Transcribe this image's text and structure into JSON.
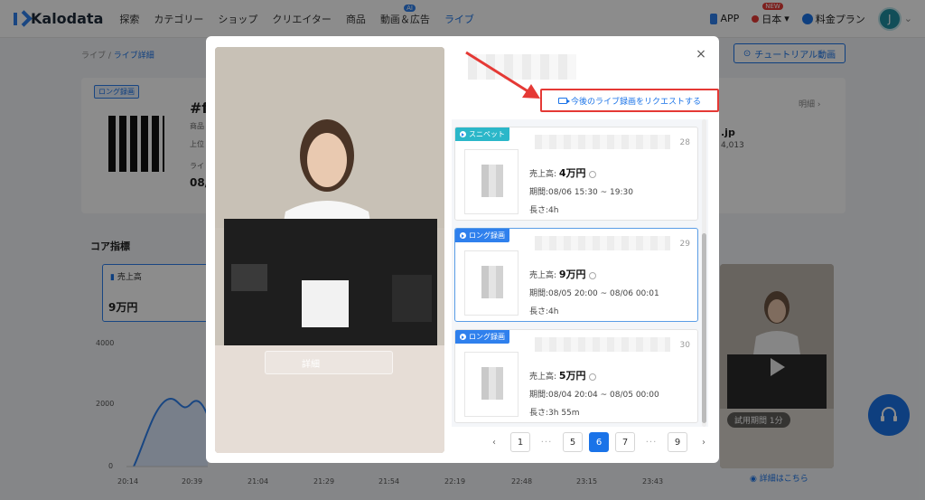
{
  "nav": {
    "logo": "Kalodata",
    "items": [
      "探索",
      "カテゴリー",
      "ショップ",
      "クリエイター",
      "商品",
      "動画＆広告",
      "ライブ"
    ],
    "ai_badge": "AI",
    "app": "APP",
    "language": "日本",
    "new_badge": "NEW",
    "plan": "料金プラン",
    "avatar_initial": "J"
  },
  "breadcrumb": {
    "root": "ライブ",
    "sep": " / ",
    "current": "ライブ詳細"
  },
  "tutorial_button": "チュートリアル動画",
  "background": {
    "long_tag": "ロング録画",
    "title_fragment": "#f",
    "small_1": "商品",
    "small_2": "上位",
    "small_3": "ライ",
    "bold_fragment": "08/",
    "detail_link": "明細 ›",
    "domain_fragment": ".jp",
    "count": "4,013",
    "core_metrics_title": "コア指標",
    "metric_label": "売上高",
    "metric_value": "9万円",
    "y_ticks": [
      "4000",
      "2000",
      "0"
    ],
    "x_ticks": [
      "20:14",
      "20:39",
      "21:04",
      "21:29",
      "21:54",
      "22:19",
      "22:48",
      "23:15",
      "23:43"
    ],
    "trial_label": "試用期間 1分",
    "side_link": "詳細はこちら"
  },
  "modal": {
    "video_detail_button": "詳細",
    "close": "×",
    "request_button": "今後のライブ録画をリクエストする",
    "items": [
      {
        "tag": "スニペット",
        "tag_type": "snippet",
        "num": "28",
        "sales_label": "売上高: ",
        "sales": "4万円",
        "period": "期間:08/06 15:30 ~ 19:30",
        "length": "長さ:4h"
      },
      {
        "tag": "ロング録画",
        "tag_type": "long",
        "num": "29",
        "sales_label": "売上高: ",
        "sales": "9万円",
        "period": "期間:08/05 20:00 ~ 08/06 00:01",
        "length": "長さ:4h"
      },
      {
        "tag": "ロング録画",
        "tag_type": "long",
        "num": "30",
        "sales_label": "売上高: ",
        "sales": "5万円",
        "period": "期間:08/04 20:04 ~ 08/05 00:00",
        "length": "長さ:3h 55m"
      }
    ],
    "pagination": {
      "prev": "‹",
      "pages": [
        "1",
        "···",
        "5",
        "6",
        "7",
        "···",
        "9"
      ],
      "current": "6",
      "next": "›"
    }
  },
  "colors": {
    "accent": "#1a73e8",
    "highlight": "#e53935",
    "snippet_tag": "#2bb7c9",
    "long_tag": "#2f80ed"
  }
}
